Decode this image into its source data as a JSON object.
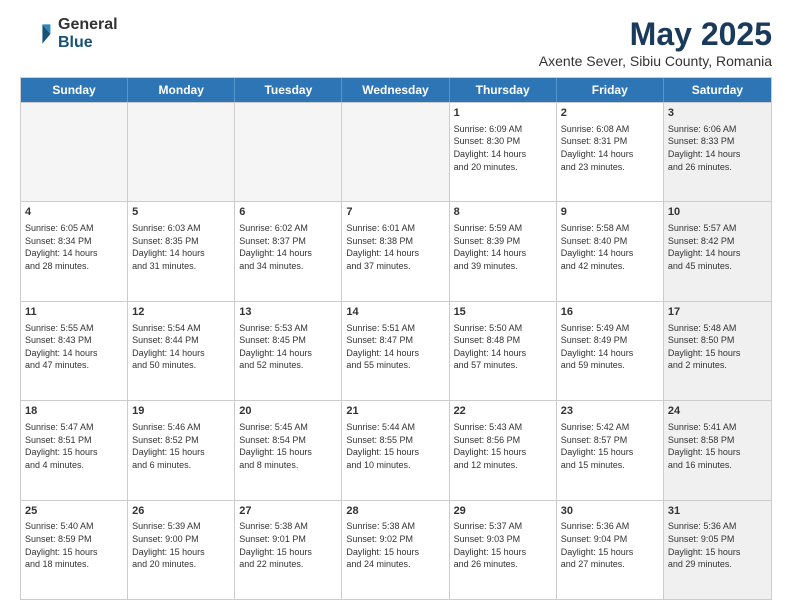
{
  "logo": {
    "general": "General",
    "blue": "Blue"
  },
  "title": "May 2025",
  "subtitle": "Axente Sever, Sibiu County, Romania",
  "header": {
    "days": [
      "Sunday",
      "Monday",
      "Tuesday",
      "Wednesday",
      "Thursday",
      "Friday",
      "Saturday"
    ]
  },
  "rows": [
    [
      {
        "day": "",
        "empty": true,
        "text": ""
      },
      {
        "day": "",
        "empty": true,
        "text": ""
      },
      {
        "day": "",
        "empty": true,
        "text": ""
      },
      {
        "day": "",
        "empty": true,
        "text": ""
      },
      {
        "day": "1",
        "text": "Sunrise: 6:09 AM\nSunset: 8:30 PM\nDaylight: 14 hours\nand 20 minutes."
      },
      {
        "day": "2",
        "text": "Sunrise: 6:08 AM\nSunset: 8:31 PM\nDaylight: 14 hours\nand 23 minutes."
      },
      {
        "day": "3",
        "shaded": true,
        "text": "Sunrise: 6:06 AM\nSunset: 8:33 PM\nDaylight: 14 hours\nand 26 minutes."
      }
    ],
    [
      {
        "day": "4",
        "text": "Sunrise: 6:05 AM\nSunset: 8:34 PM\nDaylight: 14 hours\nand 28 minutes."
      },
      {
        "day": "5",
        "text": "Sunrise: 6:03 AM\nSunset: 8:35 PM\nDaylight: 14 hours\nand 31 minutes."
      },
      {
        "day": "6",
        "text": "Sunrise: 6:02 AM\nSunset: 8:37 PM\nDaylight: 14 hours\nand 34 minutes."
      },
      {
        "day": "7",
        "text": "Sunrise: 6:01 AM\nSunset: 8:38 PM\nDaylight: 14 hours\nand 37 minutes."
      },
      {
        "day": "8",
        "text": "Sunrise: 5:59 AM\nSunset: 8:39 PM\nDaylight: 14 hours\nand 39 minutes."
      },
      {
        "day": "9",
        "text": "Sunrise: 5:58 AM\nSunset: 8:40 PM\nDaylight: 14 hours\nand 42 minutes."
      },
      {
        "day": "10",
        "shaded": true,
        "text": "Sunrise: 5:57 AM\nSunset: 8:42 PM\nDaylight: 14 hours\nand 45 minutes."
      }
    ],
    [
      {
        "day": "11",
        "text": "Sunrise: 5:55 AM\nSunset: 8:43 PM\nDaylight: 14 hours\nand 47 minutes."
      },
      {
        "day": "12",
        "text": "Sunrise: 5:54 AM\nSunset: 8:44 PM\nDaylight: 14 hours\nand 50 minutes."
      },
      {
        "day": "13",
        "text": "Sunrise: 5:53 AM\nSunset: 8:45 PM\nDaylight: 14 hours\nand 52 minutes."
      },
      {
        "day": "14",
        "text": "Sunrise: 5:51 AM\nSunset: 8:47 PM\nDaylight: 14 hours\nand 55 minutes."
      },
      {
        "day": "15",
        "text": "Sunrise: 5:50 AM\nSunset: 8:48 PM\nDaylight: 14 hours\nand 57 minutes."
      },
      {
        "day": "16",
        "text": "Sunrise: 5:49 AM\nSunset: 8:49 PM\nDaylight: 14 hours\nand 59 minutes."
      },
      {
        "day": "17",
        "shaded": true,
        "text": "Sunrise: 5:48 AM\nSunset: 8:50 PM\nDaylight: 15 hours\nand 2 minutes."
      }
    ],
    [
      {
        "day": "18",
        "text": "Sunrise: 5:47 AM\nSunset: 8:51 PM\nDaylight: 15 hours\nand 4 minutes."
      },
      {
        "day": "19",
        "text": "Sunrise: 5:46 AM\nSunset: 8:52 PM\nDaylight: 15 hours\nand 6 minutes."
      },
      {
        "day": "20",
        "text": "Sunrise: 5:45 AM\nSunset: 8:54 PM\nDaylight: 15 hours\nand 8 minutes."
      },
      {
        "day": "21",
        "text": "Sunrise: 5:44 AM\nSunset: 8:55 PM\nDaylight: 15 hours\nand 10 minutes."
      },
      {
        "day": "22",
        "text": "Sunrise: 5:43 AM\nSunset: 8:56 PM\nDaylight: 15 hours\nand 12 minutes."
      },
      {
        "day": "23",
        "text": "Sunrise: 5:42 AM\nSunset: 8:57 PM\nDaylight: 15 hours\nand 15 minutes."
      },
      {
        "day": "24",
        "shaded": true,
        "text": "Sunrise: 5:41 AM\nSunset: 8:58 PM\nDaylight: 15 hours\nand 16 minutes."
      }
    ],
    [
      {
        "day": "25",
        "text": "Sunrise: 5:40 AM\nSunset: 8:59 PM\nDaylight: 15 hours\nand 18 minutes."
      },
      {
        "day": "26",
        "text": "Sunrise: 5:39 AM\nSunset: 9:00 PM\nDaylight: 15 hours\nand 20 minutes."
      },
      {
        "day": "27",
        "text": "Sunrise: 5:38 AM\nSunset: 9:01 PM\nDaylight: 15 hours\nand 22 minutes."
      },
      {
        "day": "28",
        "text": "Sunrise: 5:38 AM\nSunset: 9:02 PM\nDaylight: 15 hours\nand 24 minutes."
      },
      {
        "day": "29",
        "text": "Sunrise: 5:37 AM\nSunset: 9:03 PM\nDaylight: 15 hours\nand 26 minutes."
      },
      {
        "day": "30",
        "text": "Sunrise: 5:36 AM\nSunset: 9:04 PM\nDaylight: 15 hours\nand 27 minutes."
      },
      {
        "day": "31",
        "shaded": true,
        "text": "Sunrise: 5:36 AM\nSunset: 9:05 PM\nDaylight: 15 hours\nand 29 minutes."
      }
    ]
  ]
}
